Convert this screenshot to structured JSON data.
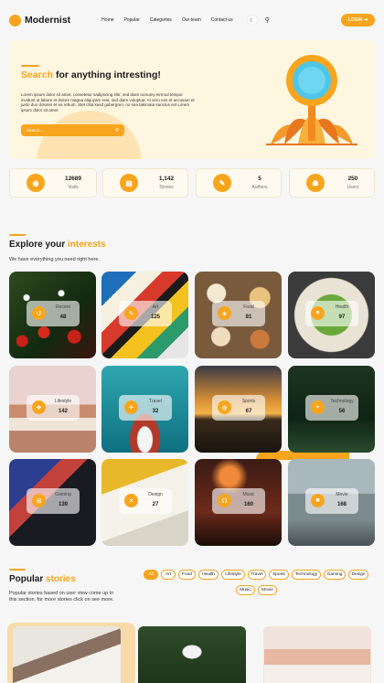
{
  "brand": {
    "name": "Modernist"
  },
  "nav": [
    "Home",
    "Popular",
    "Categories",
    "Our team",
    "Contact us"
  ],
  "header": {
    "theme_icon": "moon-icon",
    "search_icon": "search-icon",
    "login_label": "LOGIN ⇥"
  },
  "hero": {
    "title_accent": "Search",
    "title_rest": " for anything intresting!",
    "description": "Lorem ipsum dolor sit amet, consetetur sadipscing elitr, sed diam nonumy eirmod tempor invidunt ut labore et dolore magna aliquyam erat, sed diam voluptua. At vero eos et accusam et justo duo dolores et ea rebum. Stet clita kasd gubergren, no sea takimata sanctus est Lorem ipsum dolor sit amet.",
    "search_placeholder": "Search...",
    "colors": {
      "accent": "#f8a51d",
      "bg": "#fff6e0"
    }
  },
  "stats": [
    {
      "value": "12689",
      "label": "Visits",
      "icon": "eye-icon"
    },
    {
      "value": "1,142",
      "label": "Stories",
      "icon": "news-icon"
    },
    {
      "value": "5",
      "label": "Authors",
      "icon": "pen-icon"
    },
    {
      "value": "250",
      "label": "Users",
      "icon": "users-icon"
    }
  ],
  "explore": {
    "title_main": "Explore your ",
    "title_accent": "interests",
    "subtitle": "We have everything you need right here.",
    "categories": [
      {
        "name": "Recent",
        "count": "48",
        "icon": "history-icon"
      },
      {
        "name": "Art",
        "count": "125",
        "icon": "brush-icon"
      },
      {
        "name": "Food",
        "count": "81",
        "icon": "food-icon"
      },
      {
        "name": "Health",
        "count": "97",
        "icon": "heart-icon"
      },
      {
        "name": "Lifestyle",
        "count": "142",
        "icon": "lifestyle-icon"
      },
      {
        "name": "Travel",
        "count": "32",
        "icon": "plane-icon"
      },
      {
        "name": "Sports",
        "count": "67",
        "icon": "ball-icon"
      },
      {
        "name": "Technology",
        "count": "56",
        "icon": "drone-icon"
      },
      {
        "name": "Gaming",
        "count": "139",
        "icon": "gamepad-icon"
      },
      {
        "name": "Design",
        "count": "27",
        "icon": "design-icon"
      },
      {
        "name": "Music",
        "count": "160",
        "icon": "headphones-icon"
      },
      {
        "name": "Movie",
        "count": "168",
        "icon": "camera-icon"
      }
    ]
  },
  "popular": {
    "title_main": "Popular ",
    "title_accent": "stories",
    "description": "Popular stories based on user view come up in this section. for more stories click on see more.",
    "filters": [
      "All",
      "Art",
      "Food",
      "Health",
      "Lifestyle",
      "Travel",
      "Sports",
      "Technology",
      "Gaming",
      "Design",
      "Music",
      "Movie"
    ]
  }
}
